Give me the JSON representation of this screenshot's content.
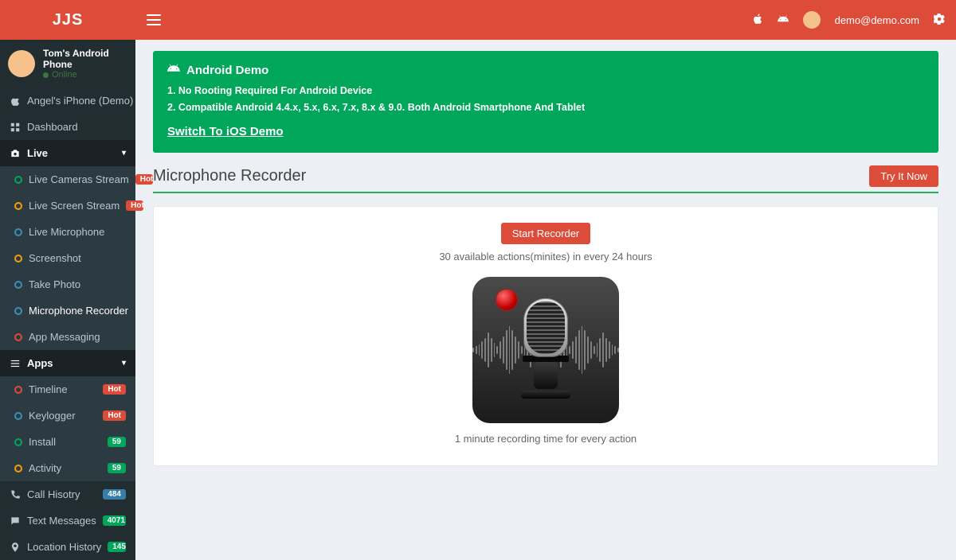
{
  "brand": "JJS",
  "top": {
    "user_email": "demo@demo.com"
  },
  "user_panel": {
    "name": "Tom's Android Phone",
    "status": "Online"
  },
  "devices": {
    "other": "Angel's iPhone (Demo)"
  },
  "nav": {
    "dashboard": "Dashboard",
    "live_header": "Live",
    "live": {
      "cameras": "Live Cameras Stream",
      "screen": "Live Screen Stream",
      "microphone": "Live Microphone",
      "screenshot": "Screenshot",
      "photo": "Take Photo",
      "mic_rec": "Microphone Recorder",
      "messaging": "App Messaging"
    },
    "badges": {
      "hot": "Hot",
      "install": "59",
      "activity": "59",
      "call": "484",
      "text": "4071",
      "loc": "145"
    },
    "apps_header": "Apps",
    "apps": {
      "timeline": "Timeline",
      "keylogger": "Keylogger",
      "install": "Install",
      "activity": "Activity"
    },
    "call": "Call Hisotry",
    "text": "Text Messages",
    "location": "Location History"
  },
  "alert": {
    "title": "Android Demo",
    "line1": "1. No Rooting Required For Android Device",
    "line2": "2. Compatible Android 4.4.x, 5.x, 6.x, 7.x, 8.x & 9.0. Both Android Smartphone And Tablet",
    "link": "Switch To iOS Demo"
  },
  "page": {
    "title": "Microphone Recorder",
    "try": "Try It Now",
    "start": "Start Recorder",
    "quota": "30 available actions(minites) in every 24 hours",
    "caption": "1 minute recording time for every action"
  }
}
